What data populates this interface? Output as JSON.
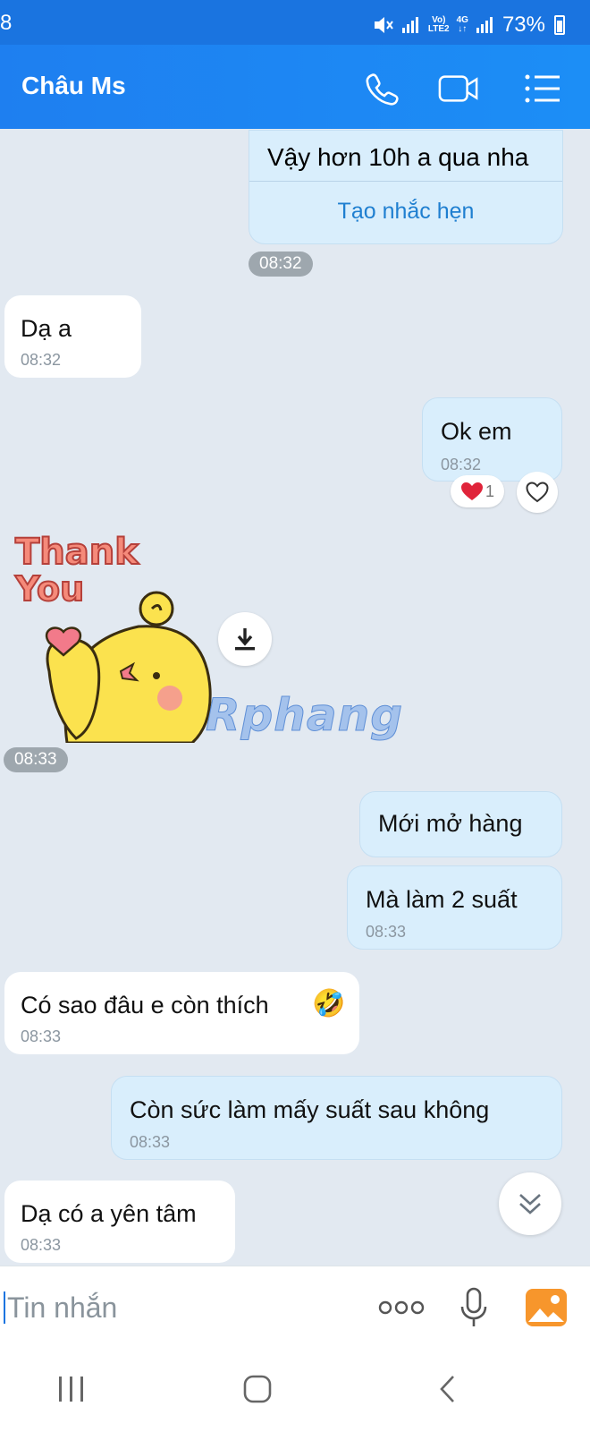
{
  "status_bar": {
    "time": "8",
    "network": [
      "Vo)",
      "LTE2"
    ],
    "network2": [
      "4G",
      "↓↑"
    ],
    "battery": "73%"
  },
  "header": {
    "title": "Châu Ms"
  },
  "messages": {
    "m1": {
      "text": "Vậy hơn 10h a qua nha",
      "action": "Tạo nhắc hẹn",
      "stamp": "08:32"
    },
    "m2": {
      "text": "Dạ a",
      "time": "08:32"
    },
    "m3": {
      "text": "Ok em",
      "time": "08:32",
      "reaction_count": "1"
    },
    "sticker": {
      "text_line1": "Thank",
      "text_line2": "You",
      "stamp": "08:33"
    },
    "m4": {
      "text": "Mới mở hàng"
    },
    "m5": {
      "text": "Mà làm 2 suất",
      "time": "08:33"
    },
    "m6": {
      "text": "Có sao đâu e còn thích",
      "emoji": "🤣",
      "time": "08:33"
    },
    "m7": {
      "text": "Còn sức làm mấy suất sau không",
      "time": "08:33"
    },
    "m8": {
      "text": "Dạ có a yên tâm",
      "time": "08:33"
    }
  },
  "watermark": "Rphang",
  "input": {
    "placeholder": "Tin nhắn"
  },
  "colors": {
    "header": "#1e7ff0",
    "my_bubble": "#d9eefc",
    "their_bubble": "#ffffff",
    "background": "#e2e9f1",
    "link": "#1f7fd0"
  }
}
